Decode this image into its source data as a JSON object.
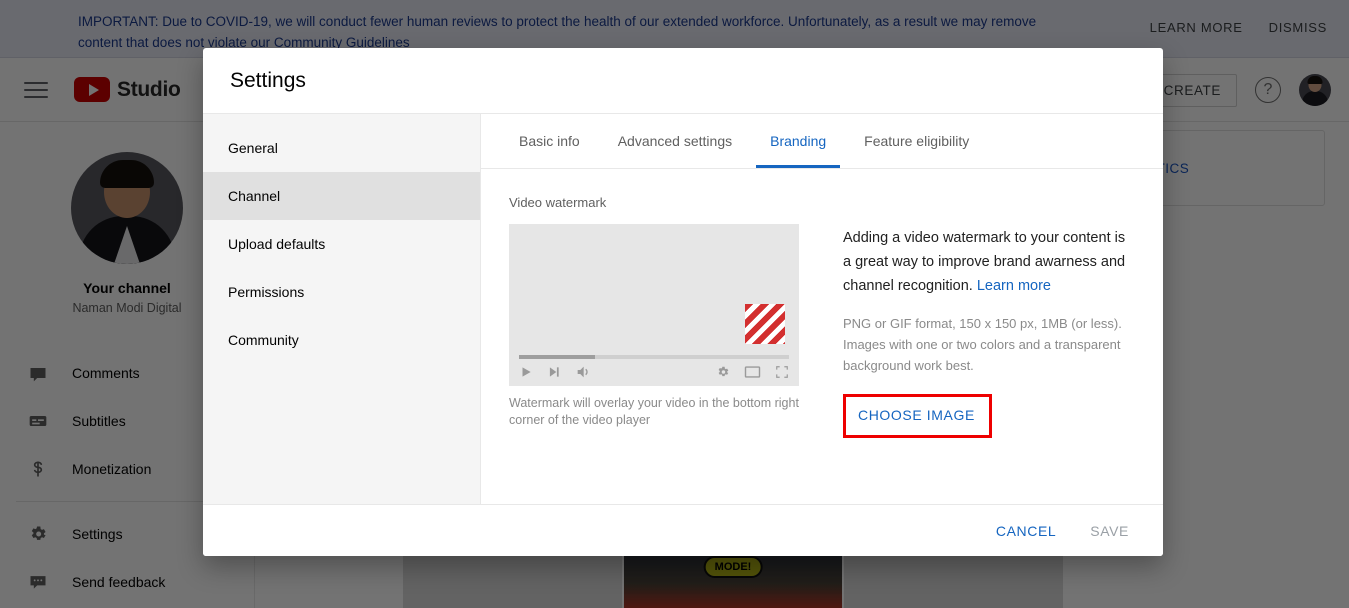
{
  "banner": {
    "text": "IMPORTANT: Due to COVID-19, we will conduct fewer human reviews to protect the health of our extended workforce. Unfortunately, as a result we may remove content that does not violate our Community Guidelines",
    "learn_more": "LEARN MORE",
    "dismiss": "DISMISS",
    "text_color": "#1b3a8f",
    "background": "#e8eaf6"
  },
  "header": {
    "logo_text": "Studio",
    "create_label": "CREATE",
    "menu_icon": "hamburger-icon",
    "help_icon": "help-circle-icon",
    "brand_color": "#cc0000"
  },
  "sidebar": {
    "channel_title": "Your channel",
    "channel_name": "Naman Modi Digital",
    "items": [
      {
        "label": "Comments",
        "icon": "comment-icon"
      },
      {
        "label": "Subtitles",
        "icon": "subtitles-icon"
      },
      {
        "label": "Monetization",
        "icon": "dollar-icon"
      },
      {
        "label": "Settings",
        "icon": "gear-icon"
      },
      {
        "label": "Send feedback",
        "icon": "feedback-icon"
      }
    ]
  },
  "background_content": {
    "analytics_label": "LYTICS",
    "thumbnail_text": "MODE!"
  },
  "dialog": {
    "title": "Settings",
    "nav": [
      {
        "label": "General",
        "active": false
      },
      {
        "label": "Channel",
        "active": true
      },
      {
        "label": "Upload defaults",
        "active": false
      },
      {
        "label": "Permissions",
        "active": false
      },
      {
        "label": "Community",
        "active": false
      }
    ],
    "tabs": [
      {
        "label": "Basic info",
        "active": false
      },
      {
        "label": "Advanced settings",
        "active": false
      },
      {
        "label": "Branding",
        "active": true
      },
      {
        "label": "Feature eligibility",
        "active": false
      }
    ],
    "section_label": "Video watermark",
    "preview_caption": "Watermark will overlay your video in the bottom right corner of the video player",
    "info_text": "Adding a video watermark to your content is a great way to improve brand awarness and channel recognition.",
    "info_link": "Learn more",
    "info_sub": "PNG or GIF format, 150 x 150 px, 1MB (or less). Images with one or two colors and a transparent background work best.",
    "choose_image_label": "CHOOSE IMAGE",
    "highlight_color": "#ee0000",
    "accent_color": "#1565c0",
    "cancel_label": "CANCEL",
    "save_label": "SAVE",
    "player_controls": {
      "play": "play-icon",
      "next": "next-icon",
      "volume": "volume-icon",
      "settings": "gear-icon",
      "theater": "theater-mode-icon",
      "fullscreen": "fullscreen-icon"
    }
  }
}
